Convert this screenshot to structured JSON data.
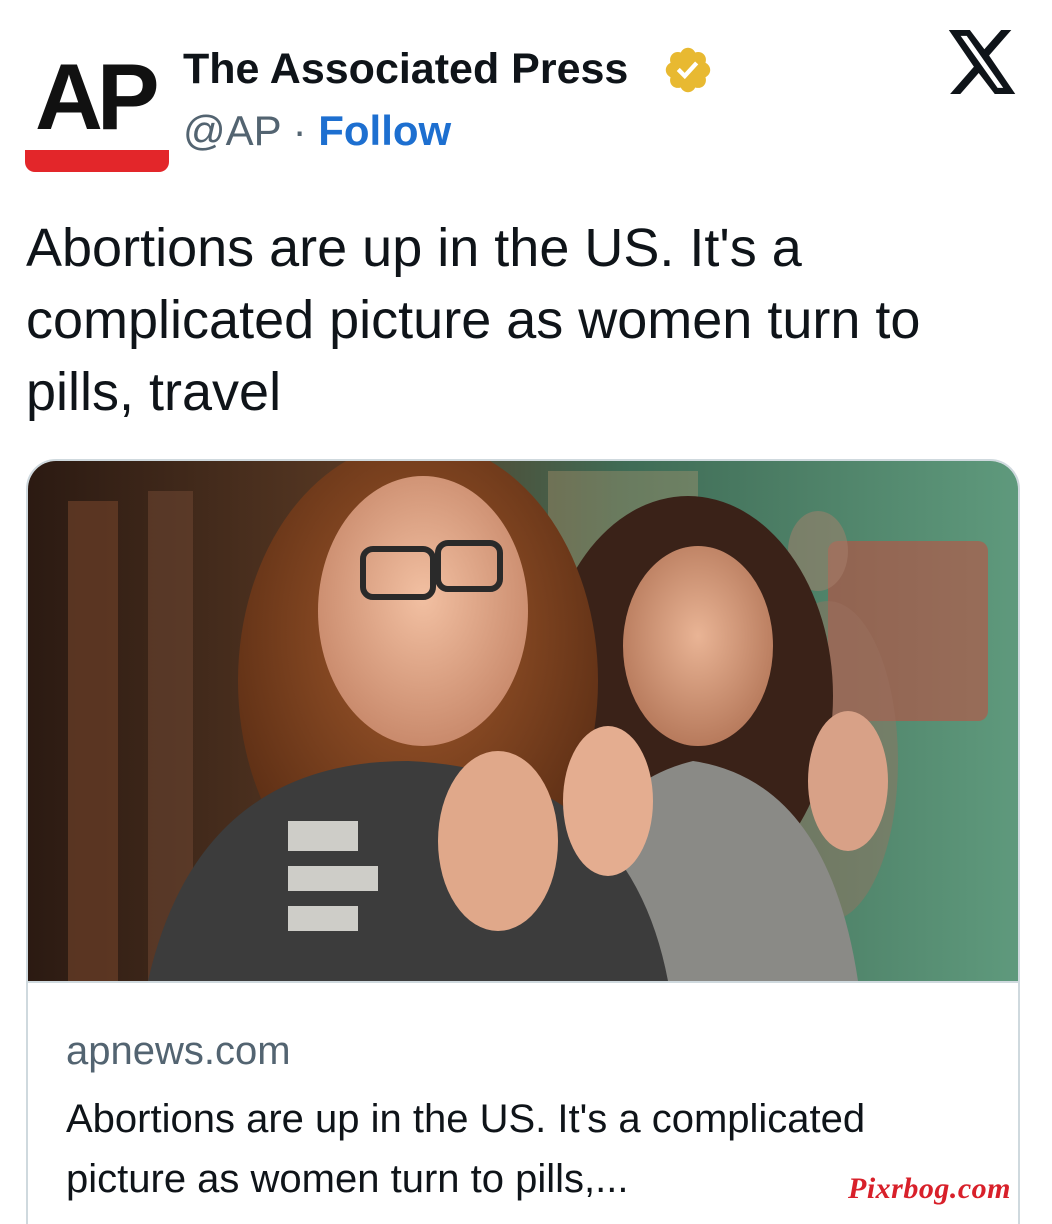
{
  "author": {
    "avatar_text": "AP",
    "display_name": "The Associated Press",
    "handle": "@AP",
    "separator": "·",
    "follow_label": "Follow",
    "verified_icon": "verified-badge-icon",
    "brand_red": "#e3262a",
    "verified_gold": "#e8b931"
  },
  "platform": {
    "logo_icon": "x-logo-icon"
  },
  "tweet": {
    "text": "Abortions are up in the US. It's a complicated picture as women turn to pills, travel"
  },
  "card": {
    "image_icon": "photo-two-women-applauding",
    "domain": "apnews.com",
    "title": "Abortions are up in the US. It's a complicated picture as women turn to pills,..."
  },
  "watermark": {
    "text": "Pixrbog.com"
  },
  "colors": {
    "text_primary": "#0f1419",
    "text_secondary": "#536471",
    "link_blue": "#1d6fd0",
    "border": "#cfd9de"
  }
}
